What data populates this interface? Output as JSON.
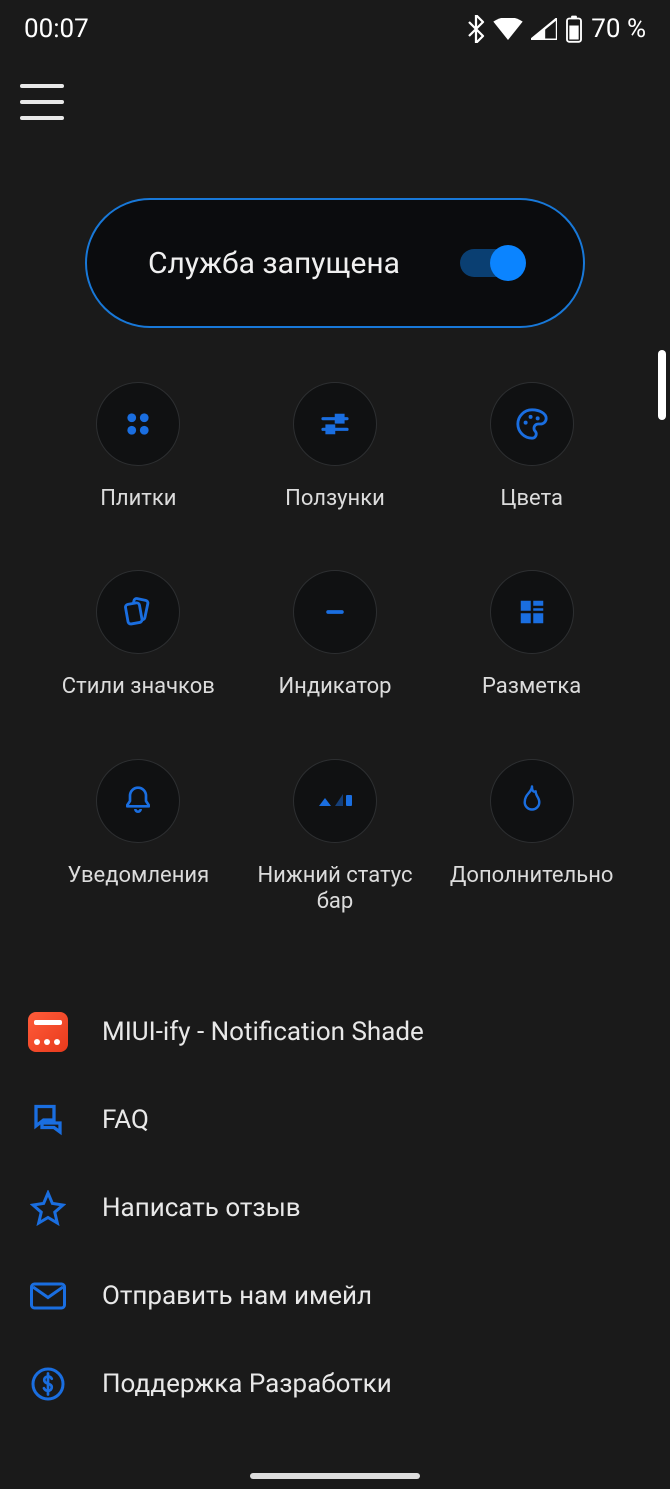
{
  "status": {
    "time": "00:07",
    "battery": "70 %"
  },
  "service": {
    "label": "Служба запущена",
    "on": true
  },
  "tiles": [
    {
      "label": "Плитки"
    },
    {
      "label": "Ползунки"
    },
    {
      "label": "Цвета"
    },
    {
      "label": "Стили значков"
    },
    {
      "label": "Индикатор"
    },
    {
      "label": "Разметка"
    },
    {
      "label": "Уведомления"
    },
    {
      "label": "Нижний статус бар"
    },
    {
      "label": "Дополнительно"
    }
  ],
  "list": [
    {
      "label": "MIUI-ify - Notification Shade"
    },
    {
      "label": "FAQ"
    },
    {
      "label": "Написать отзыв"
    },
    {
      "label": "Отправить нам имейл"
    },
    {
      "label": "Поддержка Разработки"
    }
  ],
  "colors": {
    "accent": "#1a6ee0"
  }
}
